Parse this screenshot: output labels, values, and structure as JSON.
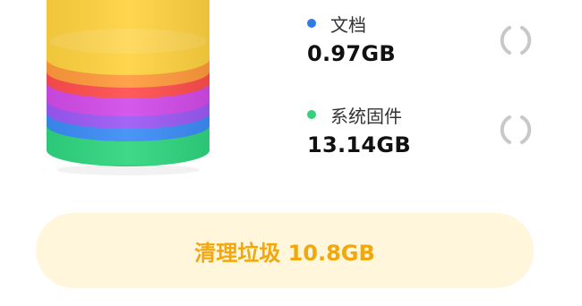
{
  "items": [
    {
      "label": "文档",
      "size": "0.97GB",
      "color": "#2F7BE8"
    },
    {
      "label": "系统固件",
      "size": "13.14GB",
      "color": "#33D17A"
    }
  ],
  "clean_button": {
    "label": "清理垃圾 10.8GB"
  },
  "colors": {
    "accent": "#F2A70C",
    "button_bg": "#FFF6DC",
    "cylinder_layers": [
      "#FFD23F",
      "#FF9A3C",
      "#FF4D4D",
      "#D14BE8",
      "#9B59F5",
      "#3B8CF5",
      "#2FD57F"
    ]
  },
  "icons": [
    "storage-cylinder-graphic",
    "loading-spinner-icon",
    "loading-spinner-icon"
  ]
}
